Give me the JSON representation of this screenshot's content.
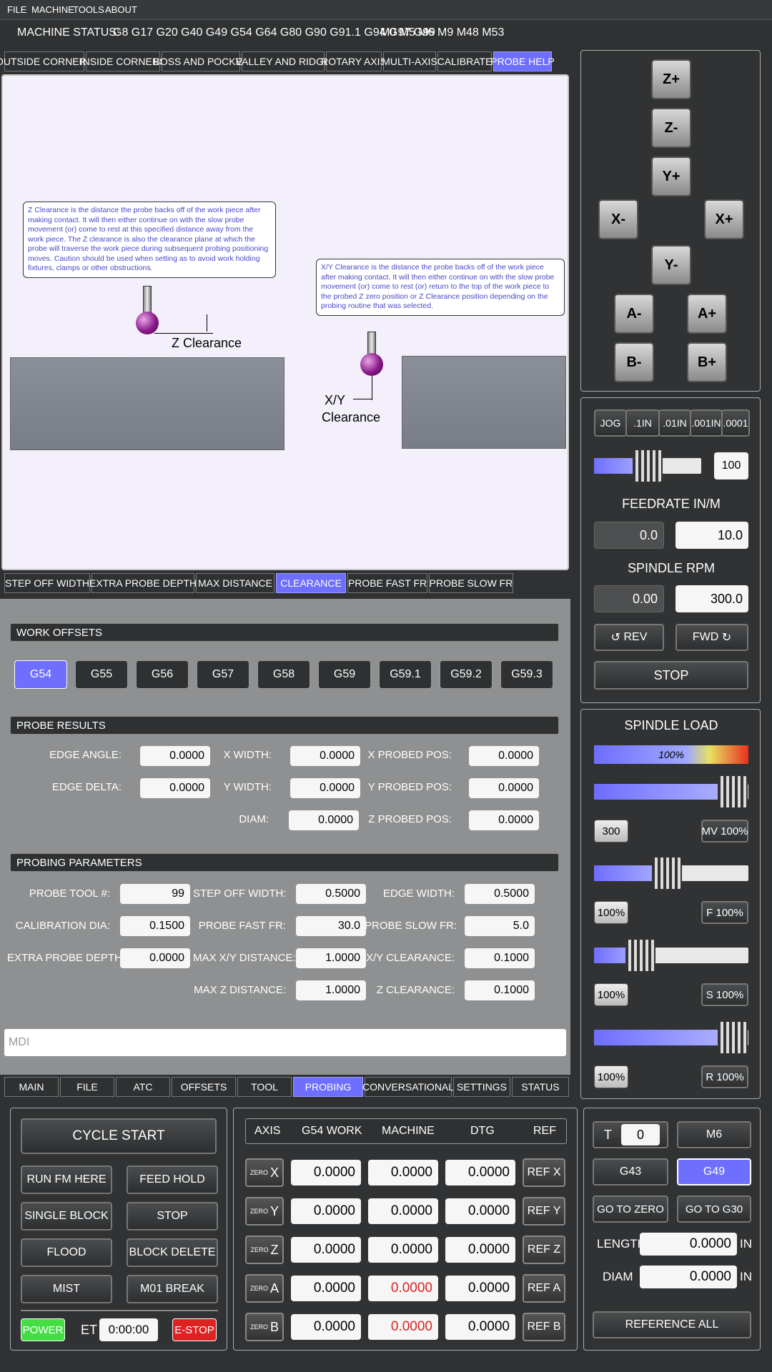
{
  "menu": [
    "FILE",
    "MACHINE",
    "TOOLS",
    "ABOUT"
  ],
  "status": {
    "label": "MACHINE STATUS:",
    "gcodes": "G8 G17 G20 G40 G49 G54 G64 G80 G90 G91.1 G94 G97 G99",
    "mcodes": "M0 M5 M6 M9 M48 M53"
  },
  "probe_tabs": [
    "OUTSIDE CORNERS",
    "INSIDE CORNERS",
    "BOSS AND POCKET",
    "VALLEY AND RIDGE",
    "ROTARY AXIS",
    "MULTI-AXIS",
    "CALIBRATE",
    "PROBE HELP"
  ],
  "help": {
    "z_note": "Z Clearance is the distance the probe backs off of the work piece after making contact.  It will then either continue on with the slow probe movement (or) come to rest at this specified distance away from the work piece.  The Z clearance is also the clearance plane at which the probe will traverse the work piece during subsequent probing positioning moves.  Caution should be used when setting as to avoid work holding fixtures, clamps or other obstructions.",
    "xy_note": "X/Y Clearance is the distance the probe backs off of the work piece after making contact.  It will then either continue on with the slow probe movement (or) come to rest (or) return to the top of the work piece to the probed Z zero position or Z Clearance position depending on the probing routine that was selected.",
    "z_label": "Z Clearance",
    "xy_label1": "X/Y",
    "xy_label2": "Clearance"
  },
  "help_tabs": [
    "STEP OFF WIDTH",
    "EXTRA PROBE DEPTH",
    "MAX DISTANCE",
    "CLEARANCE",
    "PROBE FAST FR",
    "PROBE SLOW FR"
  ],
  "work_offsets": {
    "title": "WORK OFFSETS",
    "items": [
      "G54",
      "G55",
      "G56",
      "G57",
      "G58",
      "G59",
      "G59.1",
      "G59.2",
      "G59.3"
    ]
  },
  "probe_results": {
    "title": "PROBE RESULTS",
    "edge_angle": "EDGE ANGLE:",
    "edge_angle_v": "0.0000",
    "edge_delta": "EDGE DELTA:",
    "edge_delta_v": "0.0000",
    "x_width": "X WIDTH:",
    "x_width_v": "0.0000",
    "y_width": "Y WIDTH:",
    "y_width_v": "0.0000",
    "diam": "DIAM:",
    "diam_v": "0.0000",
    "x_pos": "X PROBED POS:",
    "x_pos_v": "0.0000",
    "y_pos": "Y PROBED POS:",
    "y_pos_v": "0.0000",
    "z_pos": "Z PROBED POS:",
    "z_pos_v": "0.0000"
  },
  "params": {
    "title": "PROBING PARAMETERS",
    "tool": "PROBE TOOL #:",
    "tool_v": "99",
    "cal": "CALIBRATION DIA:",
    "cal_v": "0.1500",
    "extra": "EXTRA PROBE DEPTH:",
    "extra_v": "0.0000",
    "step": "STEP OFF WIDTH:",
    "step_v": "0.5000",
    "fast": "PROBE FAST FR:",
    "fast_v": "30.0",
    "maxxy": "MAX X/Y DISTANCE:",
    "maxxy_v": "1.0000",
    "maxz": "MAX Z DISTANCE:",
    "maxz_v": "1.0000",
    "edge": "EDGE WIDTH:",
    "edge_v": "0.5000",
    "slow": "PROBE SLOW FR:",
    "slow_v": "5.0",
    "xyc": "X/Y CLEARANCE:",
    "xyc_v": "0.1000",
    "zc": "Z CLEARANCE:",
    "zc_v": "0.1000"
  },
  "mdi_placeholder": "MDI",
  "main_tabs": [
    "MAIN",
    "FILE",
    "ATC",
    "OFFSETS",
    "TOOL",
    "PROBING",
    "CONVERSATIONAL",
    "SETTINGS",
    "STATUS"
  ],
  "jog": {
    "zp": "Z+",
    "zm": "Z-",
    "yp": "Y+",
    "ym": "Y-",
    "xm": "X-",
    "xp": "X+",
    "am": "A-",
    "ap": "A+",
    "bm": "B-",
    "bp": "B+"
  },
  "jog_steps": [
    "JOG",
    ".1IN",
    ".01IN",
    ".001IN",
    ".0001"
  ],
  "jog_rate": "100",
  "jog_rate_fraction": 0.5,
  "feed": {
    "title": "FEEDRATE IN/M",
    "actual": "0.0",
    "set": "10.0"
  },
  "spindle": {
    "title": "SPINDLE RPM",
    "actual": "0.00",
    "set": "300.0",
    "rev": "REV",
    "fwd": "FWD",
    "stop": "STOP"
  },
  "load": {
    "title": "SPINDLE LOAD",
    "bar": "100%",
    "v1": "300",
    "mv": "MV 100%",
    "v2": "100%",
    "f": "F 100%",
    "v3": "100%",
    "s": "S 100%",
    "v4": "100%",
    "r": "R 100%",
    "f1": 0.9,
    "f2": 0.47,
    "f3": 0.3,
    "f4": 0.9
  },
  "controls": {
    "cycle": "CYCLE START",
    "runfm": "RUN FM HERE",
    "hold": "FEED HOLD",
    "single": "SINGLE BLOCK",
    "stop": "STOP",
    "flood": "FLOOD",
    "bdel": "BLOCK DELETE",
    "mist": "MIST",
    "m01": "M01 BREAK",
    "power": "POWER",
    "et": "ET",
    "time": "0:00:00",
    "estop": "E-STOP"
  },
  "dro": {
    "headers": [
      "AXIS",
      "G54 WORK",
      "MACHINE",
      "DTG",
      "REF"
    ],
    "zero": "ZERO",
    "rows": [
      {
        "axis": "X",
        "work": "0.0000",
        "mach": "0.0000",
        "dtg": "0.0000",
        "ref": "REF X"
      },
      {
        "axis": "Y",
        "work": "0.0000",
        "mach": "0.0000",
        "dtg": "0.0000",
        "ref": "REF Y"
      },
      {
        "axis": "Z",
        "work": "0.0000",
        "mach": "0.0000",
        "dtg": "0.0000",
        "ref": "REF Z"
      },
      {
        "axis": "A",
        "work": "0.0000",
        "mach": "0.0000",
        "dtg": "0.0000",
        "ref": "REF A"
      },
      {
        "axis": "B",
        "work": "0.0000",
        "mach": "0.0000",
        "dtg": "0.0000",
        "ref": "REF B"
      }
    ]
  },
  "tool": {
    "t": "T",
    "t_v": "0",
    "m6": "M6",
    "g43": "G43",
    "g49": "G49",
    "gozero": "GO TO ZERO",
    "g30": "GO TO G30",
    "length": "LENGTH",
    "length_v": "0.0000",
    "diam": "DIAM",
    "diam_v": "0.0000",
    "in": "IN",
    "refall": "REFERENCE ALL"
  },
  "colors": {
    "accent": "#6e6eff",
    "power": "#44dd44",
    "estop": "#dd2222",
    "red_text": "#e02020"
  }
}
